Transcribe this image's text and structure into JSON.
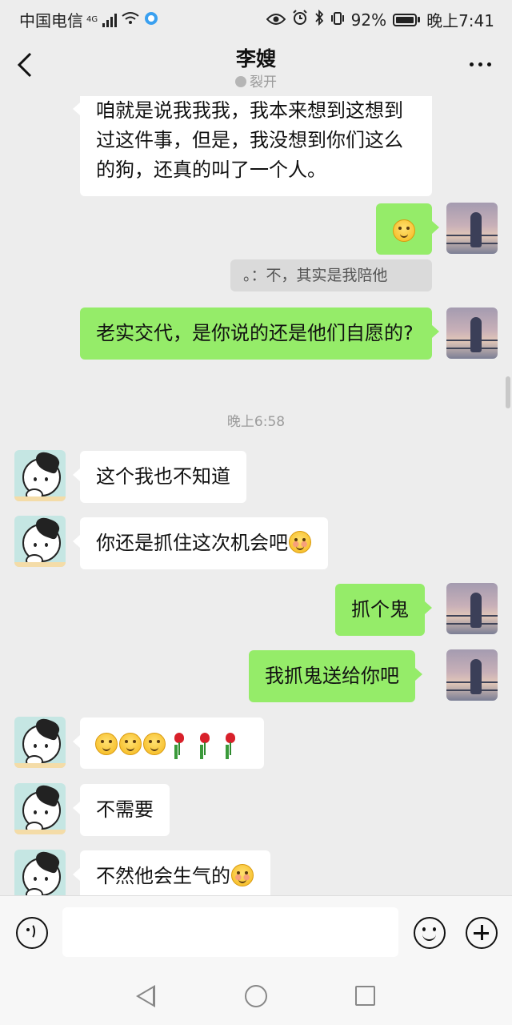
{
  "status_bar": {
    "carrier": "中国电信",
    "network": "4G",
    "battery_percent": "92%",
    "time": "晚上7:41"
  },
  "header": {
    "title": "李嫂",
    "subtitle": "裂开"
  },
  "messages": [
    {
      "from": "them",
      "text": "咱就是说我我我，我本来想到这想到过这件事，但是，我没想到你们这么的狗，还真的叫了一个人。"
    },
    {
      "from": "me",
      "emoji": "smile-emoji"
    },
    {
      "type": "system",
      "text": "。：不，其实是我陪他"
    },
    {
      "from": "me",
      "text": "老实交代，是你说的还是他们自愿的?"
    },
    {
      "type": "time",
      "text": "晚上6:58"
    },
    {
      "from": "them",
      "text": "这个我也不知道"
    },
    {
      "from": "them",
      "text": "你还是抓住这次机会吧",
      "emoji": "blush-emoji"
    },
    {
      "from": "me",
      "text": "抓个鬼"
    },
    {
      "from": "me",
      "text": "我抓鬼送给你吧"
    },
    {
      "from": "them",
      "emoji": "3x smile-emoji, 3x rose-emoji"
    },
    {
      "from": "them",
      "text": "不需要"
    },
    {
      "from": "them",
      "text": "不然他会生气的",
      "emoji": "blush-emoji"
    }
  ],
  "input": {
    "value": "",
    "placeholder": ""
  },
  "colors": {
    "outgoing_bubble": "#95ec69",
    "incoming_bubble": "#ffffff",
    "background": "#ededed"
  },
  "icons": [
    "back-arrow-icon",
    "more-icon",
    "voice-icon",
    "emoji-icon",
    "plus-icon",
    "nav-back-icon",
    "nav-home-icon",
    "nav-recent-icon"
  ]
}
